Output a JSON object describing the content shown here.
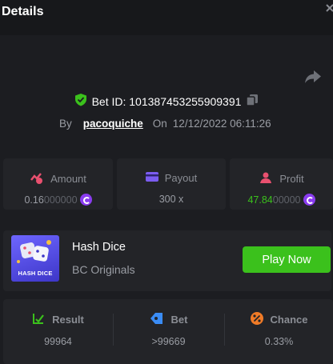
{
  "header": {
    "title": "Details"
  },
  "bet": {
    "id_text": "Bet ID: 101387453255909391",
    "by_label": "By",
    "username": "pacoquiche",
    "on_label": "On",
    "date": "12/12/2022 06:11:26"
  },
  "stats": {
    "amount": {
      "label": "Amount",
      "value_main": "0.16",
      "value_faded": "000000"
    },
    "payout": {
      "label": "Payout",
      "value": "300 x"
    },
    "profit": {
      "label": "Profit",
      "value_main": "47.84",
      "value_faded": "00000"
    }
  },
  "game": {
    "thumb_label": "HASH DICE",
    "name": "Hash Dice",
    "provider": "BC Originals",
    "play_label": "Play Now"
  },
  "results": {
    "result": {
      "label": "Result",
      "value": "99964"
    },
    "bet": {
      "label": "Bet",
      "value": ">99669"
    },
    "chance": {
      "label": "Chance",
      "value": "0.33%"
    }
  },
  "colors": {
    "accent_green": "#3bc11c",
    "coin_purple": "#8a3cf0",
    "panel": "#232428",
    "background": "#1c1d21"
  }
}
